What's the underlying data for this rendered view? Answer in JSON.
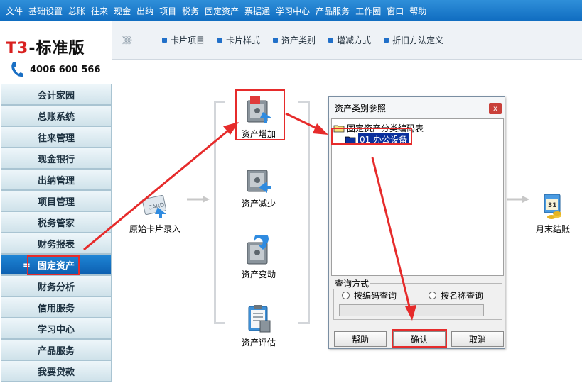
{
  "menubar": {
    "items": [
      "文件",
      "基础设置",
      "总账",
      "往来",
      "现金",
      "出纳",
      "项目",
      "税务",
      "固定资产",
      "票据通",
      "学习中心",
      "产品服务",
      "工作圈",
      "窗口",
      "帮助"
    ]
  },
  "logo": {
    "brand_prefix": "T3",
    "brand_suffix": "-标准版",
    "phone": "4006 600 566"
  },
  "nav": {
    "items": [
      "会计家园",
      "总账系统",
      "往来管理",
      "现金银行",
      "出纳管理",
      "项目管理",
      "税务管家",
      "财务报表",
      "固定资产",
      "财务分析",
      "信用服务",
      "学习中心",
      "产品服务",
      "我要贷款"
    ],
    "active_index": 8,
    "active_marker": "="
  },
  "toolbar": {
    "chevrons": "》》》",
    "items": [
      "卡片项目",
      "卡片样式",
      "资产类别",
      "增减方式",
      "折旧方法定义"
    ]
  },
  "workspace": {
    "card_entry": "原始卡片录入",
    "asset_add": "资产增加",
    "asset_reduce": "资产减少",
    "asset_change": "资产变动",
    "asset_eval": "资产评估",
    "month_end": "月末结账"
  },
  "dialog": {
    "title": "资产类别参照",
    "close": "x",
    "tree_root": "固定资产分类编码表",
    "tree_selected": "01 办公设备",
    "query_legend": "查询方式",
    "radio_code": "按编码查询",
    "radio_name": "按名称查询",
    "btn_help": "帮助",
    "btn_ok": "确认",
    "btn_cancel": "取消"
  },
  "colors": {
    "menubar": "#1a7acb",
    "nav_active": "#1478cc",
    "annotation_red": "#e62b2b",
    "selection": "#0a2f9c"
  }
}
